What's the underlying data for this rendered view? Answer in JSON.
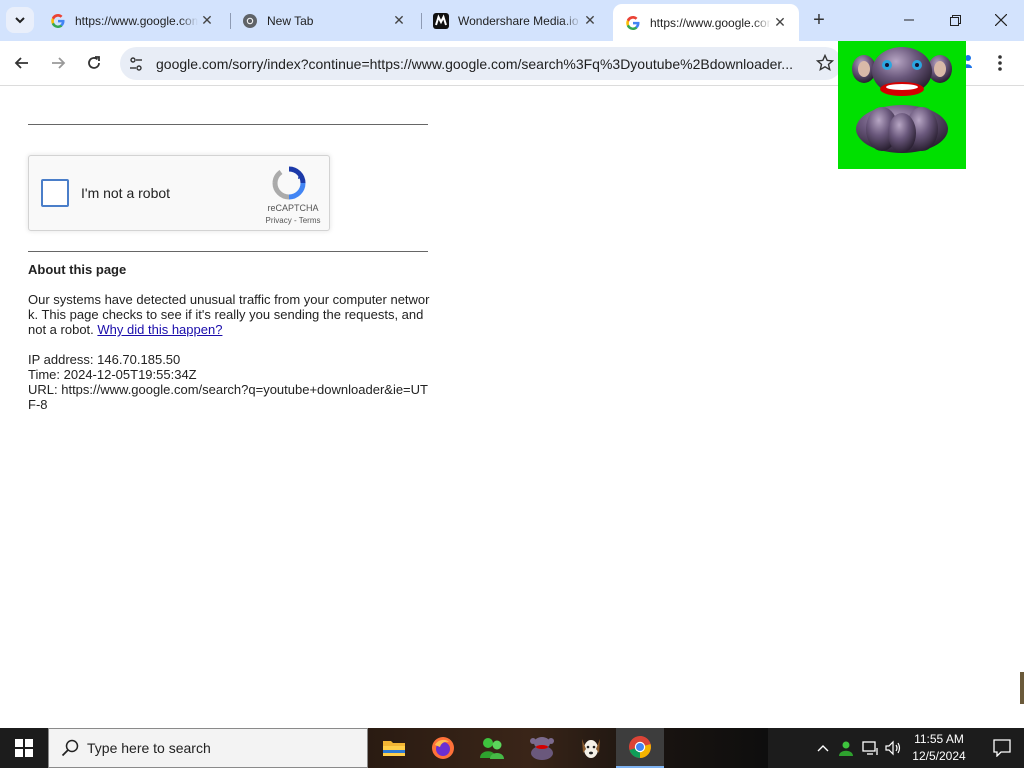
{
  "tabs": [
    {
      "title": "https://www.google.com/sorry/index",
      "favicon": "google-icon",
      "active": false
    },
    {
      "title": "New Tab",
      "favicon": "chrome-icon",
      "active": false
    },
    {
      "title": "Wondershare Media.io",
      "favicon": "mediaio-icon",
      "active": false
    },
    {
      "title": "https://www.google.com/sorry/index",
      "favicon": "google-icon",
      "active": true
    }
  ],
  "toolbar": {
    "url": "google.com/sorry/index?continue=https://www.google.com/search%3Fq%3Dyoutube%2Bdownloader..."
  },
  "recaptcha": {
    "checkbox_label": "I'm not a robot",
    "brand": "reCAPTCHA",
    "links": "Privacy - Terms"
  },
  "about": {
    "title": "About this page",
    "paragraph": "Our systems have detected unusual traffic from your computer network. This page checks to see if it's really you sending the requests, and not a robot.",
    "link": "Why did this happen?",
    "ip_line": "IP address: 146.70.185.50",
    "time_line": "Time: 2024-12-05T19:55:34Z",
    "url_line": "URL: https://www.google.com/search?q=youtube+downloader&ie=UTF-8"
  },
  "taskbar": {
    "search_placeholder": "Type here to search",
    "apps": [
      "file-explorer-icon",
      "firefox-icon",
      "people-app-icon",
      "bonzi-icon",
      "dog-app-icon",
      "chrome-icon"
    ],
    "time": "11:55 AM",
    "date": "12/5/2024"
  },
  "colors": {
    "tabstrip": "#d3e3fd",
    "omnibox": "#e8edf6",
    "link": "#1a0dab",
    "sticker_bg": "#00e000"
  }
}
